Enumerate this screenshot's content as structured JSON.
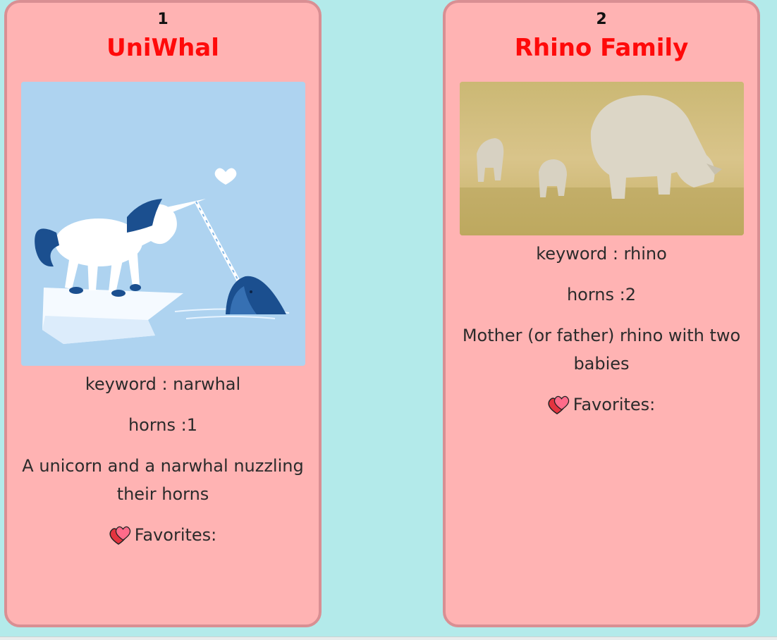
{
  "cards": [
    {
      "number": "1",
      "title": "UniWhal",
      "keyword": "keyword : narwhal",
      "horns": "horns :1",
      "description": "A unicorn and a narwhal nuzzling their horns",
      "favorites_label": "Favorites:"
    },
    {
      "number": "2",
      "title": "Rhino Family",
      "keyword": "keyword : rhino",
      "horns": "horns :2",
      "description": "Mother (or father) rhino with two babies",
      "favorites_label": "Favorites:"
    }
  ],
  "colors": {
    "page_background": "#b3eaea",
    "card_background": "#ffb3b3",
    "card_border": "#d98f93",
    "title": "#ff0a0a"
  },
  "icons": {
    "favorites": "two-hearts-icon"
  }
}
